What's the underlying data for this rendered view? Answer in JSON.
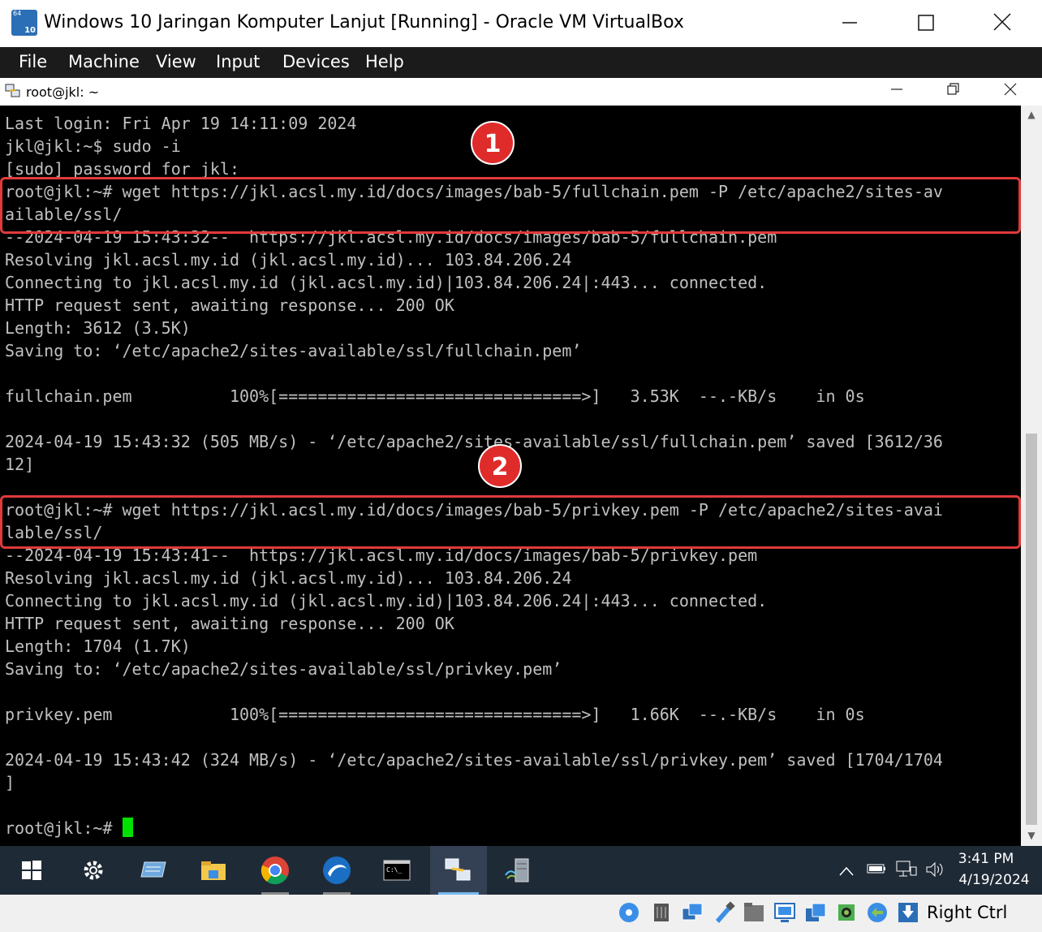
{
  "window": {
    "title": "Windows 10 Jaringan Komputer Lanjut [Running] - Oracle VM VirtualBox",
    "icon": "virtualbox-vm-icon",
    "icon_badge_top": "64",
    "icon_badge_bottom": "10"
  },
  "menubar": {
    "items": [
      "File",
      "Machine",
      "View",
      "Input",
      "Devices",
      "Help"
    ]
  },
  "putty": {
    "title": "root@jkl: ~"
  },
  "terminal": {
    "lines": [
      "Last login: Fri Apr 19 14:11:09 2024",
      "jkl@jkl:~$ sudo -i",
      "[sudo] password for jkl:",
      "root@jkl:~# wget https://jkl.acsl.my.id/docs/images/bab-5/fullchain.pem -P /etc/apache2/sites-av",
      "ailable/ssl/",
      "--2024-04-19 15:43:32--  https://jkl.acsl.my.id/docs/images/bab-5/fullchain.pem",
      "Resolving jkl.acsl.my.id (jkl.acsl.my.id)... 103.84.206.24",
      "Connecting to jkl.acsl.my.id (jkl.acsl.my.id)|103.84.206.24|:443... connected.",
      "HTTP request sent, awaiting response... 200 OK",
      "Length: 3612 (3.5K)",
      "Saving to: ‘/etc/apache2/sites-available/ssl/fullchain.pem’",
      "",
      "fullchain.pem          100%[===============================>]   3.53K  --.-KB/s    in 0s",
      "",
      "2024-04-19 15:43:32 (505 MB/s) - ‘/etc/apache2/sites-available/ssl/fullchain.pem’ saved [3612/36",
      "12]",
      "",
      "root@jkl:~# wget https://jkl.acsl.my.id/docs/images/bab-5/privkey.pem -P /etc/apache2/sites-avai",
      "lable/ssl/",
      "--2024-04-19 15:43:41--  https://jkl.acsl.my.id/docs/images/bab-5/privkey.pem",
      "Resolving jkl.acsl.my.id (jkl.acsl.my.id)... 103.84.206.24",
      "Connecting to jkl.acsl.my.id (jkl.acsl.my.id)|103.84.206.24|:443... connected.",
      "HTTP request sent, awaiting response... 200 OK",
      "Length: 1704 (1.7K)",
      "Saving to: ‘/etc/apache2/sites-available/ssl/privkey.pem’",
      "",
      "privkey.pem            100%[===============================>]   1.66K  --.-KB/s    in 0s",
      "",
      "2024-04-19 15:43:42 (324 MB/s) - ‘/etc/apache2/sites-available/ssl/privkey.pem’ saved [1704/1704",
      "]",
      "",
      "root@jkl:~# "
    ],
    "download_progress": [
      1.0,
      1.0
    ],
    "prompt": "root@jkl:~# ",
    "cursor_color": "#00e000",
    "bg_color": "#000000",
    "text_color": "#c0c0c0"
  },
  "annotations": {
    "badges": [
      "1",
      "2"
    ],
    "badge_color": "#e02b2b",
    "highlight_color": "#e03a3a"
  },
  "taskbar": {
    "apps": [
      "start-icon",
      "settings-icon",
      "hyper-v-icon",
      "file-explorer-icon",
      "chrome-icon",
      "wireshark-icon",
      "terminal-icon",
      "putty-icon",
      "server-network-icon"
    ],
    "clock_time": "3:41 PM",
    "clock_date": "4/19/2024"
  },
  "statusbar": {
    "host_key": "Right Ctrl",
    "icons": [
      "optical-drive-icon",
      "audio-icon",
      "network-icon",
      "usb-icon",
      "shared-folders-icon",
      "display-icon",
      "capture-icon",
      "recording-icon",
      "cpu-icon",
      "mouse-integration-icon",
      "keyboard-capture-icon"
    ]
  }
}
